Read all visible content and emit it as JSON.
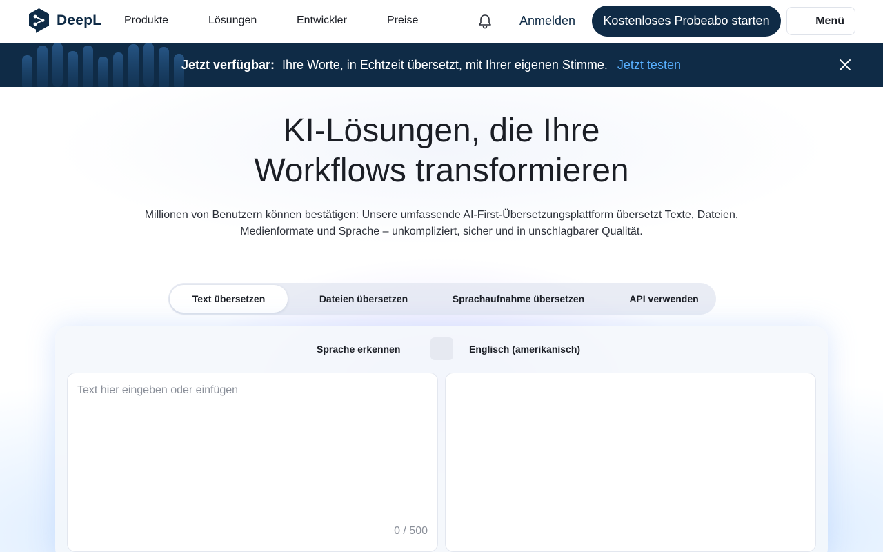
{
  "brand": {
    "name": "DeepL",
    "color": "#0f2b46"
  },
  "nav": {
    "items": [
      {
        "label": "Produkte"
      },
      {
        "label": "Lösungen"
      },
      {
        "label": "Entwickler"
      },
      {
        "label": "Preise"
      }
    ],
    "notification_icon": "bell-icon",
    "login_label": "Anmelden",
    "cta_label": "Kostenloses Probeabo starten",
    "menu_label": "Menü"
  },
  "banner": {
    "bold": "Jetzt verfügbar:",
    "text": "Ihre Worte, in Echtzeit übersetzt, mit Ihrer eigenen Stimme.",
    "link": "Jetzt testen",
    "close_icon": "close-icon"
  },
  "hero": {
    "title_line1": "KI-Lösungen, die Ihre",
    "title_line2": "Workflows transformieren",
    "subtitle_line1": "Millionen von Benutzern können bestätigen: Unsere umfassende AI-First-Übersetzungsplattform übersetzt Texte, Dateien,",
    "subtitle_line2": "Medienformate und Sprache – unkompliziert, sicher und in unschlagbarer Qualität."
  },
  "tabs": [
    {
      "label": "Text übersetzen",
      "active": true
    },
    {
      "label": "Dateien übersetzen",
      "active": false
    },
    {
      "label": "Sprachaufnahme übersetzen",
      "active": false
    },
    {
      "label": "API verwenden",
      "active": false
    }
  ],
  "translator": {
    "source_language": "Sprache erkennen",
    "target_language": "Englisch (amerikanisch)",
    "input_value": "",
    "input_placeholder": "Text hier eingeben oder einfügen",
    "char_count": "0 / 500"
  },
  "colors": {
    "primary": "#0f2b46",
    "link": "#58b0ff",
    "banner_bg": "#0f2b46"
  }
}
